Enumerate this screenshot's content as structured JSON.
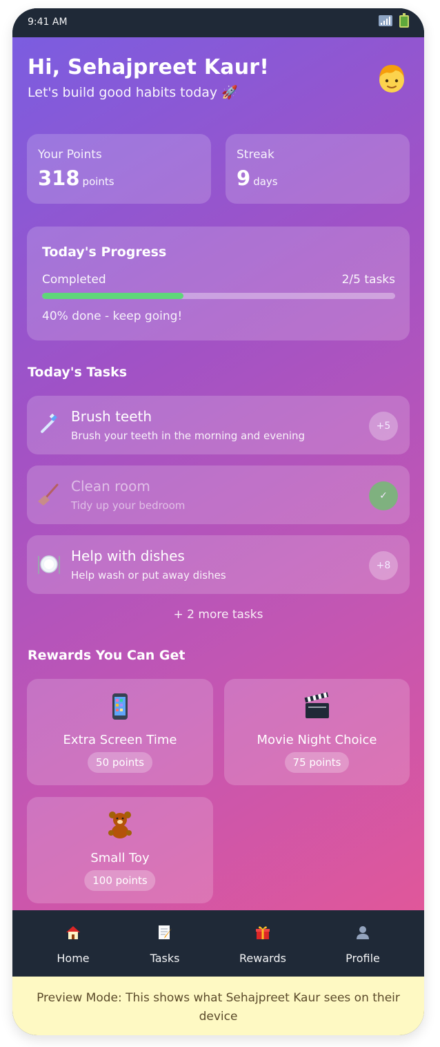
{
  "status_bar": {
    "time": "9:41 AM",
    "icons": [
      "signal-icon",
      "battery-icon"
    ]
  },
  "greeting": {
    "title": "Hi, Sehajpreet Kaur!",
    "subtitle": "Let's build good habits today 🚀",
    "avatar_icon": "boy-face-icon"
  },
  "stats": [
    {
      "label": "Your Points",
      "value": "318",
      "unit": "points"
    },
    {
      "label": "Streak",
      "value": "9",
      "unit": "days"
    }
  ],
  "progress": {
    "title": "Today's Progress",
    "label": "Completed",
    "count": "2/5 tasks",
    "fraction": 0.4,
    "message": "40% done - keep going!",
    "fill_color": "#5fd67a"
  },
  "tasks_section": {
    "title": "Today's Tasks",
    "items": [
      {
        "icon": "toothbrush-icon",
        "title": "Brush teeth",
        "desc": "Brush your teeth in the morning and evening",
        "badge": "+5",
        "done": false
      },
      {
        "icon": "broom-icon",
        "title": "Clean room",
        "desc": "Tidy up your bedroom",
        "badge": "✓",
        "done": true
      },
      {
        "icon": "plate-icon",
        "title": "Help with dishes",
        "desc": "Help wash or put away dishes",
        "badge": "+8",
        "done": false
      }
    ],
    "more": "+ 2 more tasks"
  },
  "rewards_section": {
    "title": "Rewards You Can Get",
    "items": [
      {
        "icon": "phone-icon",
        "name": "Extra Screen Time",
        "cost": "50 points"
      },
      {
        "icon": "clapperboard-icon",
        "name": "Movie Night Choice",
        "cost": "75 points"
      },
      {
        "icon": "teddy-bear-icon",
        "name": "Small Toy",
        "cost": "100 points"
      }
    ]
  },
  "nav": [
    {
      "icon": "house-icon",
      "label": "Home"
    },
    {
      "icon": "notepad-icon",
      "label": "Tasks"
    },
    {
      "icon": "gift-icon",
      "label": "Rewards"
    },
    {
      "icon": "person-icon",
      "label": "Profile"
    }
  ],
  "preview_banner": "Preview Mode: This shows what Sehajpreet Kaur sees on their device",
  "colors": {
    "gradient_start": "#7b5de0",
    "gradient_end": "#e0579a",
    "nav_bg": "#1f2937",
    "banner_bg": "#fef9c3",
    "done_badge": "#7fb17f"
  }
}
